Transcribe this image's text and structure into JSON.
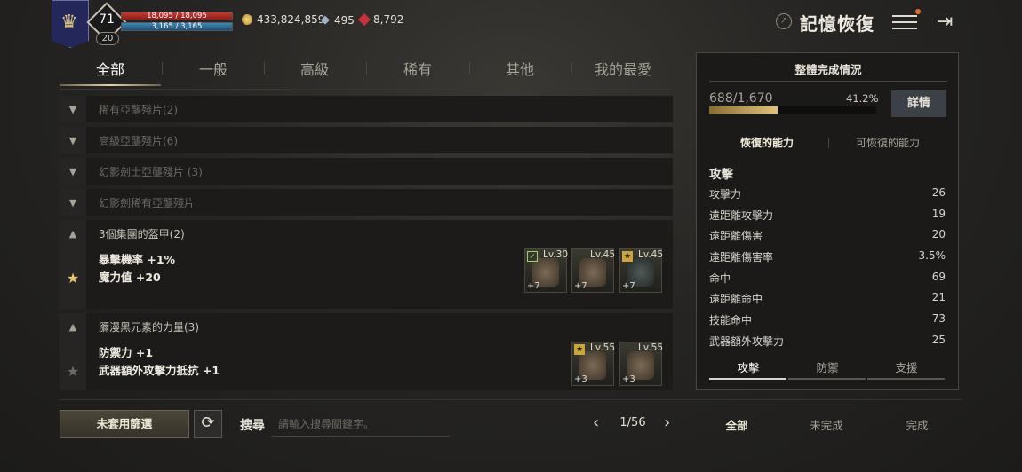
{
  "player": {
    "level": "71",
    "sub_level": "20",
    "hp": "18,095 / 18,095",
    "mp": "3,165 / 3,165"
  },
  "currency": {
    "gold": "433,824,859",
    "fish": "495",
    "gem": "8,792"
  },
  "header": {
    "title": "記憶恢復"
  },
  "tabs": [
    {
      "label": "全部",
      "active": true
    },
    {
      "label": "一般",
      "active": false
    },
    {
      "label": "高級",
      "active": false
    },
    {
      "label": "稀有",
      "active": false
    },
    {
      "label": "其他",
      "active": false
    },
    {
      "label": "我的最愛",
      "active": false
    }
  ],
  "list": {
    "collapsed_rows": [
      {
        "label": "稀有亞壟殘片(2)"
      },
      {
        "label": "高級亞壟殘片(6)"
      },
      {
        "label": "幻影劍士亞壟殘片 (3)"
      },
      {
        "label": "幻影劍稀有亞壟殘片"
      }
    ],
    "groups": [
      {
        "label": "3個集團的盔甲(2)",
        "stats": [
          "暴擊機率 +1%",
          "魔力值 +20"
        ],
        "favorite": true,
        "items": [
          {
            "level": "Lv.30",
            "plus": "+7",
            "badge": "✓"
          },
          {
            "level": "Lv.45",
            "plus": "+7",
            "badge": ""
          },
          {
            "level": "Lv.45",
            "plus": "+7",
            "badge": "★"
          }
        ]
      },
      {
        "label": "瀰漫黑元素的力量(3)",
        "stats": [
          "防禦力 +1",
          "武器額外攻擊力抵抗 +1"
        ],
        "favorite": false,
        "items": [
          {
            "level": "Lv.55",
            "plus": "+3",
            "badge": "★"
          },
          {
            "level": "Lv.55",
            "plus": "+3",
            "badge": ""
          }
        ]
      }
    ]
  },
  "panel": {
    "title": "整體完成情況",
    "progress_text": "688/1,670",
    "progress_pct": "41.2%",
    "progress_value": 0.412,
    "detail_label": "詳情",
    "subtabs": [
      {
        "label": "恢復的能力",
        "active": true
      },
      {
        "label": "可恢復的能力",
        "active": false
      }
    ],
    "section_title": "攻擊",
    "stats": [
      {
        "name": "攻擊力",
        "value": "26"
      },
      {
        "name": "遠距離攻擊力",
        "value": "19"
      },
      {
        "name": "遠距離傷害",
        "value": "20"
      },
      {
        "name": "遠距離傷害率",
        "value": "3.5%"
      },
      {
        "name": "命中",
        "value": "69"
      },
      {
        "name": "遠距離命中",
        "value": "21"
      },
      {
        "name": "技能命中",
        "value": "73"
      },
      {
        "name": "武器額外攻擊力",
        "value": "25"
      }
    ],
    "bottom_tabs": [
      {
        "label": "攻擊",
        "active": true
      },
      {
        "label": "防禦",
        "active": false
      },
      {
        "label": "支援",
        "active": false
      }
    ]
  },
  "footer": {
    "filter_label": "未套用篩選",
    "search_label": "搜尋",
    "search_placeholder": "請輸入搜尋關鍵字。",
    "page": "1/56",
    "filter_tabs": [
      {
        "label": "全部",
        "active": true
      },
      {
        "label": "未完成",
        "active": false
      },
      {
        "label": "完成",
        "active": false
      }
    ]
  }
}
